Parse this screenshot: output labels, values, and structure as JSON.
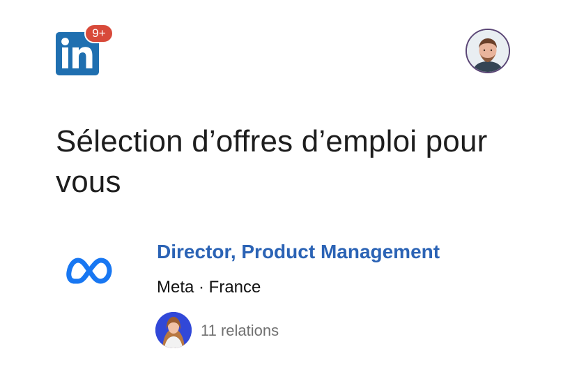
{
  "header": {
    "notification_badge": "9+",
    "logo_icon": "linkedin-logo-icon",
    "profile_icon": "profile-avatar"
  },
  "page": {
    "title": "Sélection d’offres d’emploi pour vous"
  },
  "job": {
    "title": "Director, Product Management",
    "company_and_location": "Meta · France",
    "relations": "11 relations",
    "company_logo_icon": "meta-logo-icon"
  },
  "colors": {
    "linkedin_blue": "#1f6fb0",
    "badge_red": "#d84a3a",
    "job_title_blue": "#2b63b5",
    "meta_blue": "#1877f2"
  }
}
